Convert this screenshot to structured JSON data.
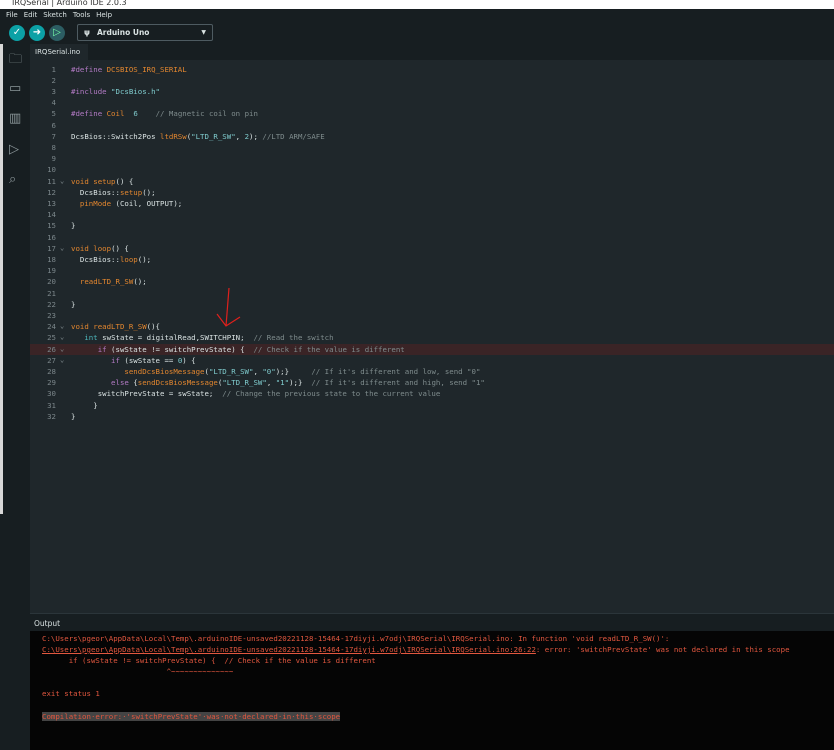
{
  "window": {
    "title": "IRQSerial | Arduino IDE 2.0.3"
  },
  "menu": [
    "File",
    "Edit",
    "Sketch",
    "Tools",
    "Help"
  ],
  "toolbar": {
    "board": "Arduino Uno"
  },
  "tab": "IRQSerial.ino",
  "editor": {
    "error_line": 26,
    "lines": [
      [
        [
          "p",
          "#define "
        ],
        [
          "o",
          "DCSBIOS_IRQ_SERIAL"
        ]
      ],
      [],
      [
        [
          "p",
          "#include "
        ],
        [
          "s",
          "\"DcsBios.h\""
        ]
      ],
      [],
      [
        [
          "p",
          "#define "
        ],
        [
          "o",
          "Coil"
        ],
        [
          "t",
          "  "
        ],
        [
          "n",
          "6"
        ],
        [
          "c",
          "    // Magnetic coil on pin"
        ]
      ],
      [],
      [
        [
          "t",
          "DcsBios::Switch2Pos "
        ],
        [
          "o",
          "ltdRSw"
        ],
        [
          "t",
          "("
        ],
        [
          "s",
          "\"LTD_R_SW\""
        ],
        [
          "t",
          ", "
        ],
        [
          "n",
          "2"
        ],
        [
          "t",
          "); "
        ],
        [
          "c",
          "//LTD ARM/SAFE"
        ]
      ],
      [],
      [],
      [],
      [
        [
          "o",
          "void "
        ],
        [
          "o",
          "setup"
        ],
        [
          "t",
          "() {"
        ]
      ],
      [
        [
          "t",
          "  DcsBios::"
        ],
        [
          "o",
          "setup"
        ],
        [
          "t",
          "();"
        ]
      ],
      [
        [
          "t",
          "  "
        ],
        [
          "o",
          "pinMode"
        ],
        [
          "t",
          " (Coil, OUTPUT);"
        ]
      ],
      [],
      [
        [
          "t",
          "}"
        ]
      ],
      [],
      [
        [
          "o",
          "void "
        ],
        [
          "o",
          "loop"
        ],
        [
          "t",
          "() {"
        ]
      ],
      [
        [
          "t",
          "  DcsBios::"
        ],
        [
          "o",
          "loop"
        ],
        [
          "t",
          "();"
        ]
      ],
      [],
      [
        [
          "t",
          "  "
        ],
        [
          "o",
          "readLTD_R_SW"
        ],
        [
          "t",
          "();"
        ]
      ],
      [],
      [
        [
          "t",
          "}"
        ]
      ],
      [],
      [
        [
          "o",
          "void "
        ],
        [
          "o",
          "readLTD_R_SW"
        ],
        [
          "t",
          "(){"
        ]
      ],
      [
        [
          "t",
          "   "
        ],
        [
          "ty",
          "int"
        ],
        [
          "t",
          " swState = digitalRead,SWITCHPIN;  "
        ],
        [
          "c",
          "// Read the switch"
        ]
      ],
      [
        [
          "t",
          "      "
        ],
        [
          "k",
          "if"
        ],
        [
          "t",
          " (swState != switchPrevState) {  "
        ],
        [
          "c",
          "// Check if the value is different"
        ]
      ],
      [
        [
          "t",
          "         "
        ],
        [
          "k",
          "if"
        ],
        [
          "t",
          " (swState == "
        ],
        [
          "n",
          "0"
        ],
        [
          "t",
          ") {"
        ]
      ],
      [
        [
          "t",
          "            "
        ],
        [
          "o",
          "sendDcsBiosMessage"
        ],
        [
          "t",
          "("
        ],
        [
          "s",
          "\"LTD_R_SW\""
        ],
        [
          "t",
          ", "
        ],
        [
          "s",
          "\"0\""
        ],
        [
          "t",
          ");}     "
        ],
        [
          "c",
          "// If it's different and low, send \"0\""
        ]
      ],
      [
        [
          "t",
          "         "
        ],
        [
          "k",
          "else"
        ],
        [
          "t",
          " {"
        ],
        [
          "o",
          "sendDcsBiosMessage"
        ],
        [
          "t",
          "("
        ],
        [
          "s",
          "\"LTD_R_SW\""
        ],
        [
          "t",
          ", "
        ],
        [
          "s",
          "\"1\""
        ],
        [
          "t",
          ");}  "
        ],
        [
          "c",
          "// If it's different and high, send \"1\""
        ]
      ],
      [
        [
          "t",
          "      switchPrevState = swState;  "
        ],
        [
          "c",
          "// Change the previous state to the current value"
        ]
      ],
      [
        [
          "t",
          "     }"
        ]
      ],
      [
        [
          "t",
          "}"
        ]
      ]
    ],
    "folds": [
      11,
      17,
      24,
      25,
      26,
      27
    ]
  },
  "output": {
    "title": "Output",
    "lines": [
      "C:\\Users\\pgeor\\AppData\\Local\\Temp\\.arduinoIDE-unsaved20221128-15464-17diyji.w7odj\\IRQSerial\\IRQSerial.ino: In function 'void readLTD_R_SW()':",
      "C:\\Users\\pgeor\\AppData\\Local\\Temp\\.arduinoIDE-unsaved20221128-15464-17diyji.w7odj\\IRQSerial\\IRQSerial.ino:26:22",
      ": error: 'switchPrevState' was not declared in this scope",
      "      if (swState != switchPrevState) {  // Check if the value is different",
      "                            ^~~~~~~~~~~~~~~",
      "exit status 1",
      "Compilation·error:·'switchPrevState'·was·not·declared·in·this·scope"
    ]
  }
}
